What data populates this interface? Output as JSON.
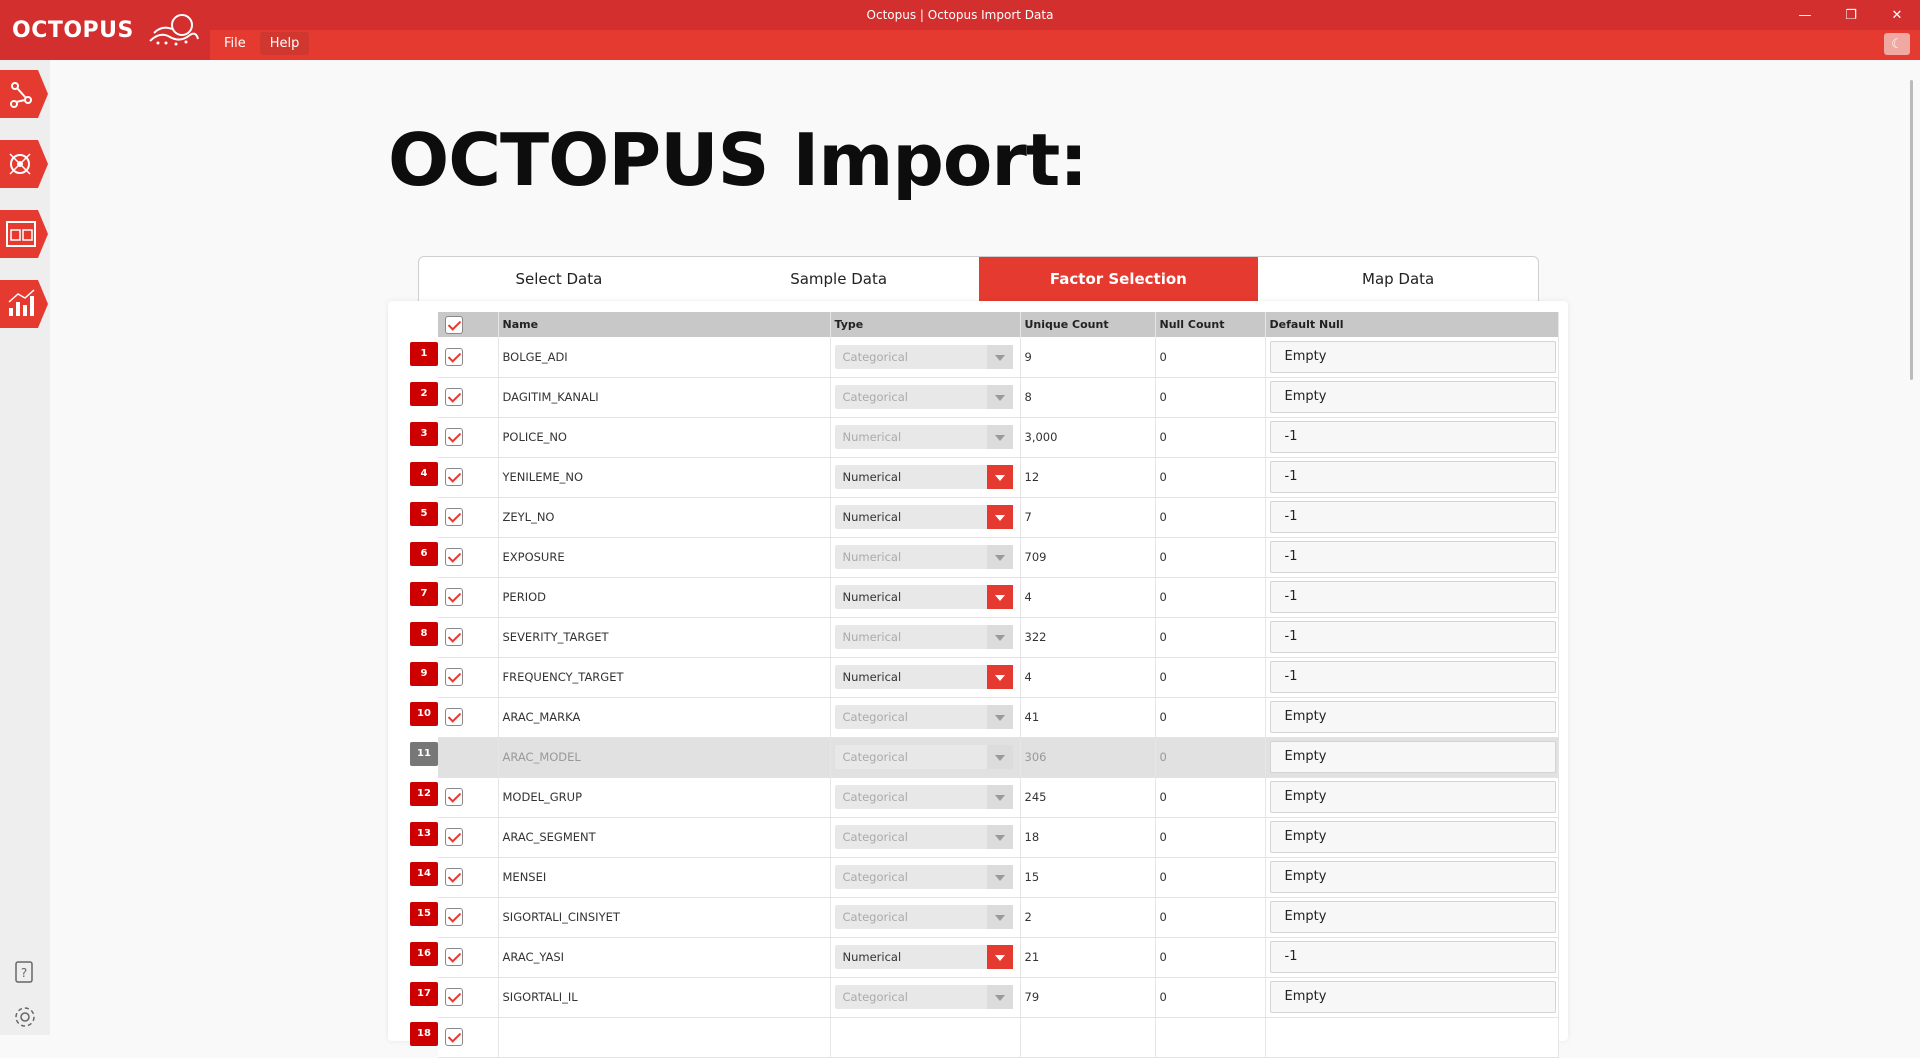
{
  "window": {
    "title": "Octopus | Octopus Import Data",
    "logo_text": "OCTOPUS",
    "menu": [
      "File",
      "Help"
    ],
    "controls": [
      "—",
      "❐",
      "✕"
    ],
    "theme_icon": "moon-icon"
  },
  "sidebar": {
    "items": [
      "network-icon",
      "molecule-icon",
      "dashboard-icon",
      "analytics-chart-icon"
    ],
    "bottom": [
      "help-icon",
      "settings-icon"
    ]
  },
  "page": {
    "heading": "OCTOPUS Import:"
  },
  "tabs": [
    {
      "label": "Select Data",
      "active": false
    },
    {
      "label": "Sample Data",
      "active": false
    },
    {
      "label": "Factor Selection",
      "active": true
    },
    {
      "label": "Map Data",
      "active": false
    }
  ],
  "table": {
    "columns": {
      "name": "Name",
      "type": "Type",
      "unique": "Unique Count",
      "null": "Null Count",
      "default": "Default Null"
    },
    "rows": [
      {
        "n": "1",
        "checked": true,
        "name": "BOLGE_ADI",
        "type": "Categorical",
        "editable": false,
        "unique": "9",
        "nulls": "0",
        "default": "Empty"
      },
      {
        "n": "2",
        "checked": true,
        "name": "DAGITIM_KANALI",
        "type": "Categorical",
        "editable": false,
        "unique": "8",
        "nulls": "0",
        "default": "Empty"
      },
      {
        "n": "3",
        "checked": true,
        "name": "POLICE_NO",
        "type": "Numerical",
        "editable": false,
        "unique": "3,000",
        "nulls": "0",
        "default": "-1"
      },
      {
        "n": "4",
        "checked": true,
        "name": "YENILEME_NO",
        "type": "Numerical",
        "editable": true,
        "unique": "12",
        "nulls": "0",
        "default": "-1"
      },
      {
        "n": "5",
        "checked": true,
        "name": "ZEYL_NO",
        "type": "Numerical",
        "editable": true,
        "unique": "7",
        "nulls": "0",
        "default": "-1"
      },
      {
        "n": "6",
        "checked": true,
        "name": "EXPOSURE",
        "type": "Numerical",
        "editable": false,
        "unique": "709",
        "nulls": "0",
        "default": "-1"
      },
      {
        "n": "7",
        "checked": true,
        "name": "PERIOD",
        "type": "Numerical",
        "editable": true,
        "unique": "4",
        "nulls": "0",
        "default": "-1"
      },
      {
        "n": "8",
        "checked": true,
        "name": "SEVERITY_TARGET",
        "type": "Numerical",
        "editable": false,
        "unique": "322",
        "nulls": "0",
        "default": "-1"
      },
      {
        "n": "9",
        "checked": true,
        "name": "FREQUENCY_TARGET",
        "type": "Numerical",
        "editable": true,
        "unique": "4",
        "nulls": "0",
        "default": "-1"
      },
      {
        "n": "10",
        "checked": true,
        "name": "ARAC_MARKA",
        "type": "Categorical",
        "editable": false,
        "unique": "41",
        "nulls": "0",
        "default": "Empty"
      },
      {
        "n": "11",
        "checked": false,
        "name": "ARAC_MODEL",
        "type": "Categorical",
        "editable": false,
        "unique": "306",
        "nulls": "0",
        "default": "Empty"
      },
      {
        "n": "12",
        "checked": true,
        "name": "MODEL_GRUP",
        "type": "Categorical",
        "editable": false,
        "unique": "245",
        "nulls": "0",
        "default": "Empty"
      },
      {
        "n": "13",
        "checked": true,
        "name": "ARAC_SEGMENT",
        "type": "Categorical",
        "editable": false,
        "unique": "18",
        "nulls": "0",
        "default": "Empty"
      },
      {
        "n": "14",
        "checked": true,
        "name": "MENSEI",
        "type": "Categorical",
        "editable": false,
        "unique": "15",
        "nulls": "0",
        "default": "Empty"
      },
      {
        "n": "15",
        "checked": true,
        "name": "SIGORTALI_CINSIYET",
        "type": "Categorical",
        "editable": false,
        "unique": "2",
        "nulls": "0",
        "default": "Empty"
      },
      {
        "n": "16",
        "checked": true,
        "name": "ARAC_YASI",
        "type": "Numerical",
        "editable": true,
        "unique": "21",
        "nulls": "0",
        "default": "-1"
      },
      {
        "n": "17",
        "checked": true,
        "name": "SIGORTALI_IL",
        "type": "Categorical",
        "editable": false,
        "unique": "79",
        "nulls": "0",
        "default": "Empty"
      },
      {
        "n": "18",
        "checked": true,
        "name": "",
        "type": "",
        "editable": true,
        "unique": "",
        "nulls": "",
        "default": ""
      }
    ]
  },
  "colors": {
    "accent": "#e53a30",
    "accent_dark": "#cc0000",
    "header_bg": "#c8c8c8"
  }
}
